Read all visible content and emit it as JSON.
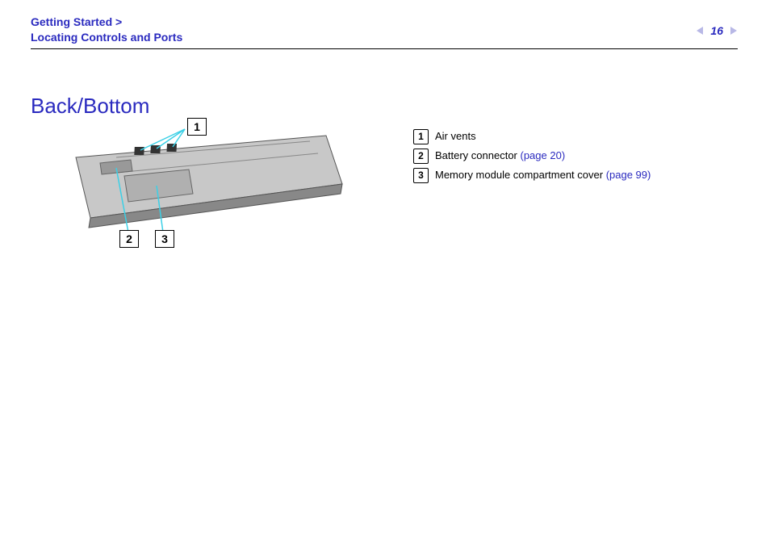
{
  "breadcrumb": {
    "chapter": "Getting Started >",
    "section": "Locating Controls and Ports"
  },
  "page_number": "16",
  "heading": "Back/Bottom",
  "callouts": {
    "c1": "1",
    "c2": "2",
    "c3": "3"
  },
  "legend": {
    "item1": {
      "num": "1",
      "text": "Air vents"
    },
    "item2": {
      "num": "2",
      "text": "Battery connector ",
      "link": "(page 20)"
    },
    "item3": {
      "num": "3",
      "text": "Memory module compartment cover ",
      "link": "(page 99)"
    }
  }
}
